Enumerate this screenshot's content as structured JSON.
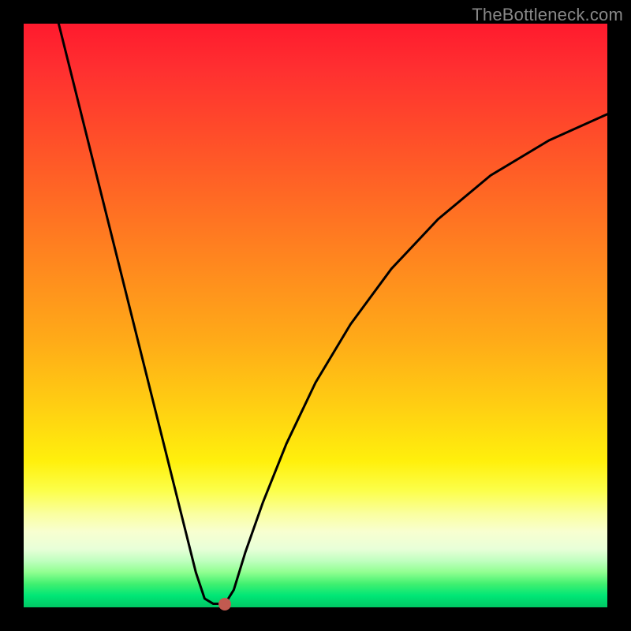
{
  "watermark": "TheBottleneck.com",
  "chart_data": {
    "type": "line",
    "title": "",
    "xlabel": "",
    "ylabel": "",
    "xlim": [
      0,
      1
    ],
    "ylim": [
      0,
      1
    ],
    "series": [
      {
        "name": "bottleneck-curve",
        "points": [
          {
            "x": 0.06,
            "y": 1.0
          },
          {
            "x": 0.09,
            "y": 0.88
          },
          {
            "x": 0.12,
            "y": 0.76
          },
          {
            "x": 0.15,
            "y": 0.64
          },
          {
            "x": 0.18,
            "y": 0.52
          },
          {
            "x": 0.21,
            "y": 0.4
          },
          {
            "x": 0.24,
            "y": 0.28
          },
          {
            "x": 0.27,
            "y": 0.16
          },
          {
            "x": 0.295,
            "y": 0.06
          },
          {
            "x": 0.31,
            "y": 0.015
          },
          {
            "x": 0.325,
            "y": 0.006
          },
          {
            "x": 0.345,
            "y": 0.006
          },
          {
            "x": 0.36,
            "y": 0.03
          },
          {
            "x": 0.38,
            "y": 0.095
          },
          {
            "x": 0.41,
            "y": 0.18
          },
          {
            "x": 0.45,
            "y": 0.28
          },
          {
            "x": 0.5,
            "y": 0.385
          },
          {
            "x": 0.56,
            "y": 0.485
          },
          {
            "x": 0.63,
            "y": 0.58
          },
          {
            "x": 0.71,
            "y": 0.665
          },
          {
            "x": 0.8,
            "y": 0.74
          },
          {
            "x": 0.9,
            "y": 0.8
          },
          {
            "x": 1.0,
            "y": 0.845
          }
        ]
      }
    ],
    "marker": {
      "x": 0.345,
      "y": 0.006,
      "color": "#c25a50",
      "size": 16
    },
    "gradient_note": "background encodes bottleneck severity: red=high, yellow=medium, green=low"
  }
}
